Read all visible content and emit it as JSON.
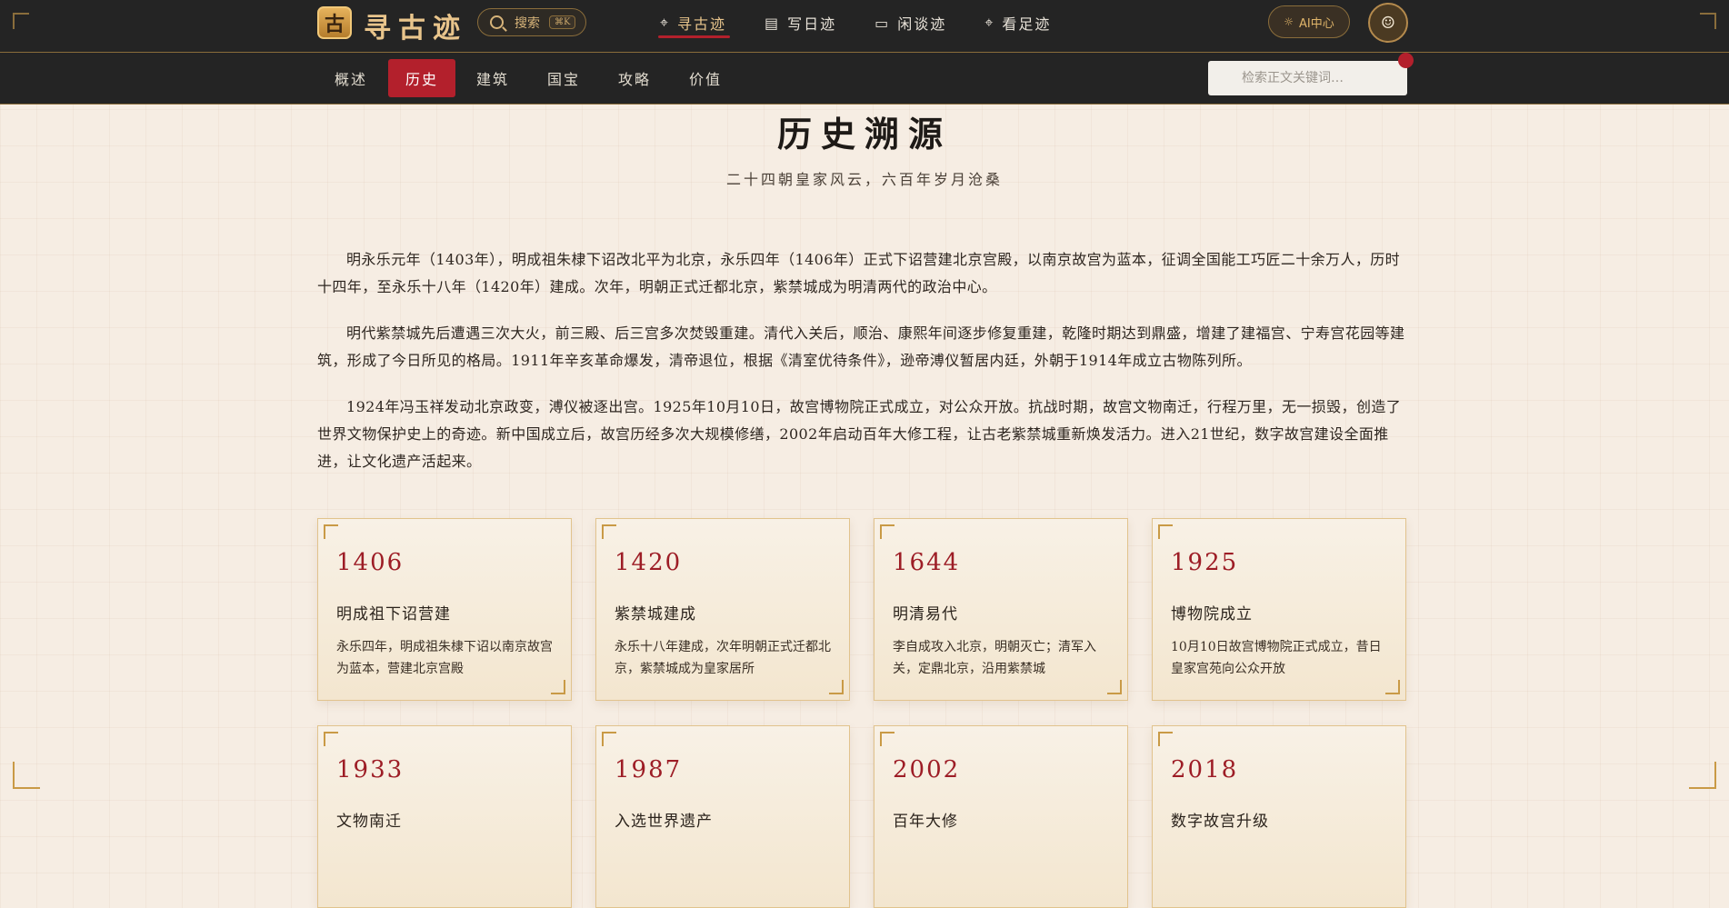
{
  "header": {
    "logo_char": "古",
    "logo_text": "寻古迹",
    "search_label": "搜索",
    "search_shortcut": "⌘K",
    "nav": [
      {
        "label": "寻古迹",
        "icon": "map-pin-icon",
        "active": true
      },
      {
        "label": "写日迹",
        "icon": "document-icon",
        "active": false
      },
      {
        "label": "闲谈迹",
        "icon": "chat-icon",
        "active": false
      },
      {
        "label": "看足迹",
        "icon": "map-pin-icon",
        "active": false
      }
    ],
    "ai_label": "AI中心",
    "accent_color": "#e9c58c",
    "active_color": "#b3202c"
  },
  "subnav": {
    "tabs": [
      "概述",
      "历史",
      "建筑",
      "国宝",
      "攻略",
      "价值"
    ],
    "active_tab": "历史",
    "search_placeholder": "检索正文关键词…"
  },
  "main": {
    "title": "历史溯源",
    "subtitle": "二十四朝皇家风云，六百年岁月沧桑",
    "paragraphs": [
      "明永乐元年（1403年），明成祖朱棣下诏改北平为北京，永乐四年（1406年）正式下诏营建北京宫殿，以南京故宫为蓝本，征调全国能工巧匠二十余万人，历时十四年，至永乐十八年（1420年）建成。次年，明朝正式迁都北京，紫禁城成为明清两代的政治中心。",
      "明代紫禁城先后遭遇三次大火，前三殿、后三宫多次焚毁重建。清代入关后，顺治、康熙年间逐步修复重建，乾隆时期达到鼎盛，增建了建福宫、宁寿宫花园等建筑，形成了今日所见的格局。1911年辛亥革命爆发，清帝退位，根据《清室优待条件》，逊帝溥仪暂居内廷，外朝于1914年成立古物陈列所。",
      "1924年冯玉祥发动北京政变，溥仪被逐出宫。1925年10月10日，故宫博物院正式成立，对公众开放。抗战时期，故宫文物南迁，行程万里，无一损毁，创造了世界文物保护史上的奇迹。新中国成立后，故宫历经多次大规模修缮，2002年启动百年大修工程，让古老紫禁城重新焕发活力。进入21世纪，数字故宫建设全面推进，让文化遗产活起来。"
    ],
    "timeline": [
      {
        "year": "1406",
        "title": "明成祖下诏营建",
        "desc": "永乐四年，明成祖朱棣下诏以南京故宫为蓝本，营建北京宫殿"
      },
      {
        "year": "1420",
        "title": "紫禁城建成",
        "desc": "永乐十八年建成，次年明朝正式迁都北京，紫禁城成为皇家居所"
      },
      {
        "year": "1644",
        "title": "明清易代",
        "desc": "李自成攻入北京，明朝灭亡；清军入关，定鼎北京，沿用紫禁城"
      },
      {
        "year": "1925",
        "title": "博物院成立",
        "desc": "10月10日故宫博物院正式成立，昔日皇家宫苑向公众开放"
      },
      {
        "year": "1933",
        "title": "文物南迁",
        "desc": ""
      },
      {
        "year": "1987",
        "title": "入选世界遗产",
        "desc": ""
      },
      {
        "year": "2002",
        "title": "百年大修",
        "desc": ""
      },
      {
        "year": "2018",
        "title": "数字故宫升级",
        "desc": ""
      }
    ],
    "year_color": "#9d1d26"
  }
}
